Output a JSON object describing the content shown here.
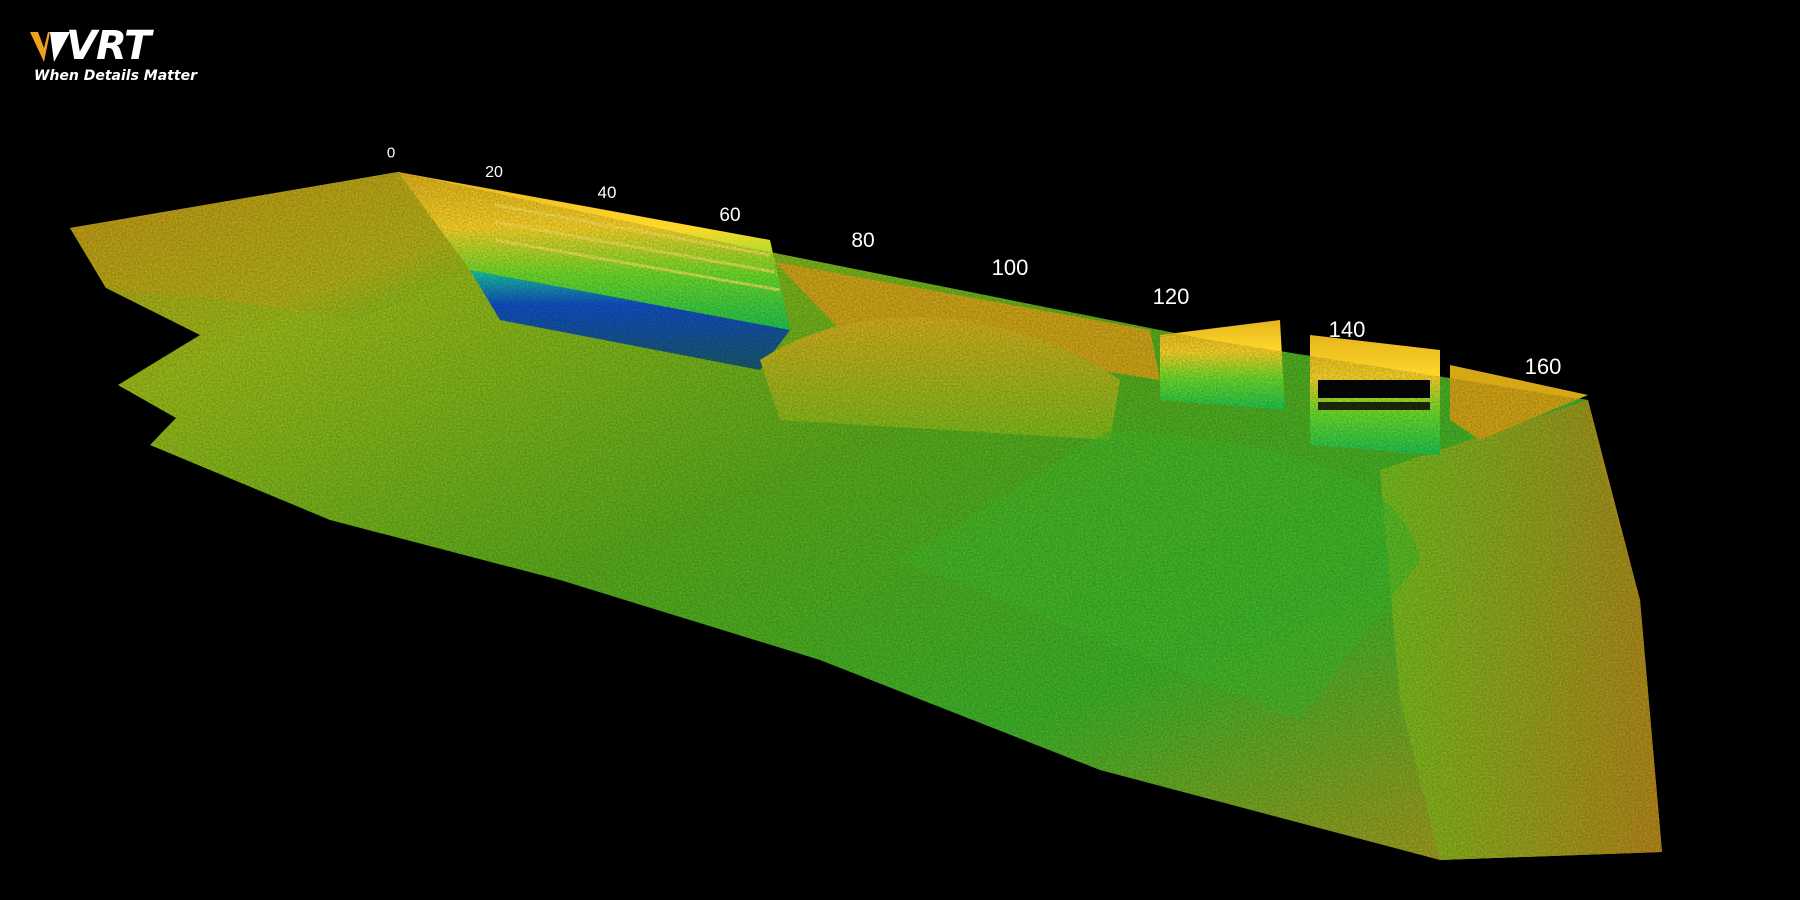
{
  "logo": {
    "brand": "VRT",
    "tagline": "When Details Matter",
    "accent_color": "#f0a020"
  },
  "scale_labels": [
    "0",
    "20",
    "40",
    "60",
    "80",
    "100",
    "120",
    "140",
    "160"
  ],
  "colormap": {
    "type": "elevation",
    "colors": [
      "#1a3fbf",
      "#12a0d8",
      "#1fcf4a",
      "#7fd21a",
      "#d4d41a",
      "#d6a816",
      "#b98a12"
    ]
  }
}
